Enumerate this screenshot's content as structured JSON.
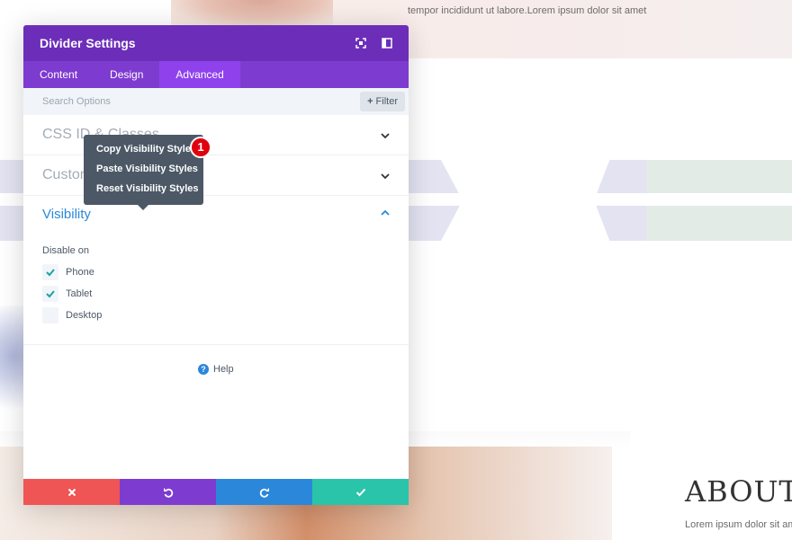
{
  "background": {
    "top_text": "tempor incididunt ut labore.Lorem ipsum dolor sit amet",
    "about_title": "ABOUT I",
    "about_text": "Lorem ipsum dolor sit am"
  },
  "modal": {
    "title": "Divider Settings",
    "header_icons": [
      "expand-icon",
      "split-view-icon"
    ],
    "tabs": [
      {
        "label": "Content",
        "active": false
      },
      {
        "label": "Design",
        "active": false
      },
      {
        "label": "Advanced",
        "active": true
      }
    ],
    "search": {
      "placeholder": "Search Options",
      "filter_label": "Filter"
    },
    "sections": {
      "css": {
        "title": "CSS ID & Classes"
      },
      "custom": {
        "title": "Custom CSS"
      },
      "visibility": {
        "title": "Visibility",
        "disable_label": "Disable on",
        "options": [
          {
            "label": "Phone",
            "checked": true
          },
          {
            "label": "Tablet",
            "checked": true
          },
          {
            "label": "Desktop",
            "checked": false
          }
        ]
      }
    },
    "help_label": "Help",
    "footer_buttons": [
      "close-icon",
      "undo-icon",
      "redo-icon",
      "check-icon"
    ]
  },
  "context_menu": {
    "items": [
      "Copy Visibility Styles",
      "Paste Visibility Styles",
      "Reset Visibility Styles"
    ],
    "badge": "1"
  },
  "colors": {
    "header": "#6c2eb9",
    "tabs": "#7e3bd0",
    "active_tab": "#8f42ec",
    "accent_blue": "#2b87da",
    "cancel": "#ef5555",
    "save": "#29c4a9",
    "badge": "#e0000e"
  }
}
